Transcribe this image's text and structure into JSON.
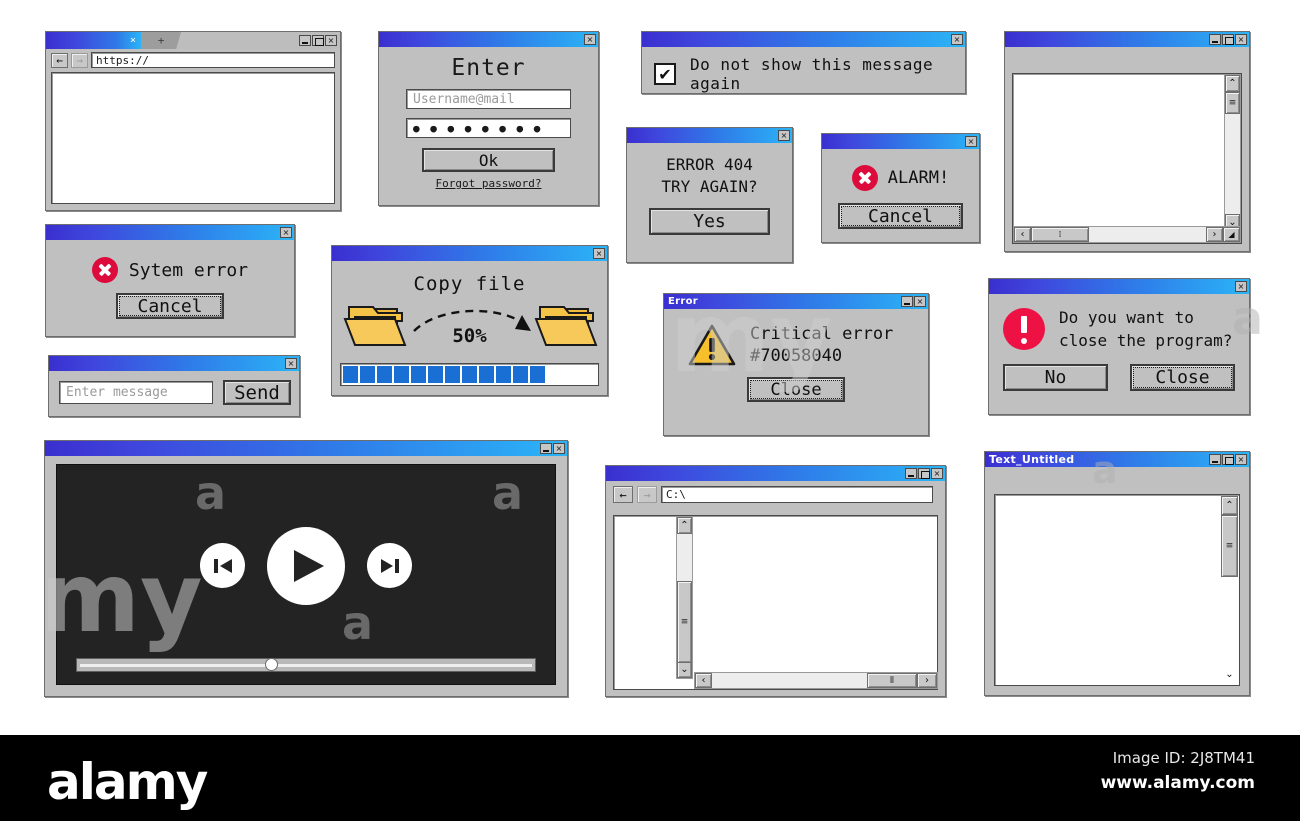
{
  "browser_window": {
    "name": "Browser window",
    "tab_close_glyph": "×",
    "new_tab_glyph": "+",
    "back_glyph": "←",
    "forward_glyph": "→",
    "url_value": "https://",
    "buttons": {
      "minimize": "_",
      "maximize": "□",
      "close": "×"
    }
  },
  "login_dialog": {
    "title": "",
    "heading": "Enter",
    "username_placeholder": "Username@mail",
    "password_dots": "● ● ● ● ● ● ● ●",
    "ok_label": "Ok",
    "forgot_label": "Forgot password?",
    "close_glyph": "×"
  },
  "checkbox_dialog": {
    "checkbox_glyph": "✔",
    "label": "Do not show this message again",
    "close_glyph": "×"
  },
  "error404_dialog": {
    "line1": "ERROR 404",
    "line2": "TRY AGAIN?",
    "button_label": "Yes",
    "close_glyph": "×"
  },
  "alarm_dialog": {
    "icon": "error-circle-icon",
    "message": "ALARM!",
    "button_label": "Cancel",
    "close_glyph": "×"
  },
  "scroll_window": {
    "buttons": {
      "minimize": "_",
      "maximize": "□",
      "close": "×"
    },
    "scroll_up": "⌃",
    "scroll_down": "⌄",
    "scroll_left": "‹",
    "scroll_right": "›",
    "thumb_glyph": "≡",
    "hthumb_glyph": "⁞",
    "resize_glyph": "◢"
  },
  "system_error_dialog": {
    "icon": "error-circle-icon",
    "message": "Sytem error",
    "button_label": "Cancel",
    "close_glyph": "×"
  },
  "copy_file_dialog": {
    "heading": "Copy file",
    "percent_label": "50%",
    "progress_percent": 50,
    "progress_segments": 12,
    "source_icon": "folder-icon",
    "target_icon": "folder-icon",
    "arrow_icon": "dashed-arrow-icon",
    "close_glyph": "×"
  },
  "critical_error_dialog": {
    "title": "Error",
    "icon": "warning-triangle-icon",
    "line1": "Critical error",
    "line2": "#70058040",
    "button_label": "Close",
    "buttons": {
      "minimize": "_",
      "close": "×"
    }
  },
  "close_program_dialog": {
    "icon": "exclamation-circle-icon",
    "line1": "Do you want to",
    "line2": "close the program?",
    "no_label": "No",
    "close_label": "Close",
    "close_glyph": "×"
  },
  "message_dialog": {
    "input_placeholder": "Enter message",
    "send_label": "Send",
    "close_glyph": "×"
  },
  "video_player": {
    "buttons": {
      "minimize": "_",
      "close": "×"
    },
    "prev_icon": "skip-previous-icon",
    "play_icon": "play-icon",
    "next_icon": "skip-next-icon",
    "progress_percent": 41
  },
  "file_explorer": {
    "back_glyph": "←",
    "forward_glyph": "→",
    "path_value": "C:\\",
    "buttons": {
      "minimize": "_",
      "maximize": "□",
      "close": "×"
    },
    "scroll_up": "⌃",
    "scroll_down": "⌄",
    "scroll_left": "‹",
    "scroll_right": "›",
    "thumb_glyph": "≡",
    "hthumb_glyph": "⦀"
  },
  "text_editor": {
    "title": "Text_Untitled",
    "buttons": {
      "minimize": "_",
      "maximize": "□",
      "close": "×"
    },
    "scroll_up": "⌃",
    "scroll_down": "⌄",
    "thumb_glyph": "≡"
  },
  "watermark": {
    "word_my": "my",
    "word_alamy": "alamy",
    "letters": [
      "a",
      "a",
      "a",
      "a",
      "a"
    ]
  },
  "footer": {
    "logo": "alamy",
    "image_id": "Image ID: 2J8TM41",
    "url": "www.alamy.com"
  },
  "colors": {
    "title_gradient_start": "#3a2fd0",
    "title_gradient_end": "#2bb4f7",
    "window_face": "#c0c0c0",
    "error_red": "#dd0b3c",
    "alert_red": "#ed1144",
    "progress_blue": "#1a6fd4",
    "folder_yellow": "#f5c447",
    "warning_yellow": "#f5c02b",
    "video_bg": "#232323"
  }
}
